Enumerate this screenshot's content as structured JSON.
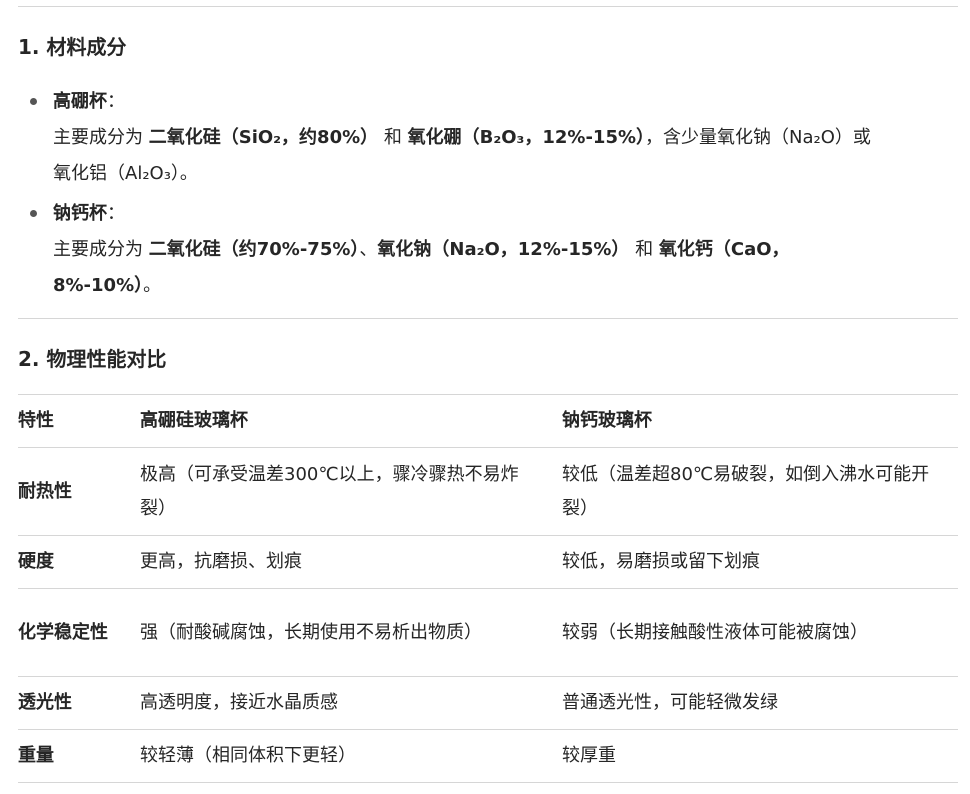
{
  "section1": {
    "title": "1. 材料成分",
    "items": [
      {
        "term": "高硼杯",
        "colon": "：",
        "lines": [
          {
            "a": "主要成分为 ",
            "b1": "二氧化硅（SiO₂，约80%）",
            "c": " 和 ",
            "b2": "氧化硼（B₂O₃，12%-15%）",
            "d": "，含少量氧化钠（Na₂O）或"
          },
          {
            "text": "氧化铝（Al₂O₃）。"
          }
        ]
      },
      {
        "term": "钠钙杯",
        "colon": "：",
        "lines": [
          {
            "a": "主要成分为 ",
            "b1": "二氧化硅（约70%-75%）",
            "c": "、",
            "b2": "氧化钠（Na₂O，12%-15%）",
            "d": " 和 ",
            "b3": "氧化钙（CaO，"
          },
          {
            "b": "8%-10%）",
            "text": "。"
          }
        ]
      }
    ]
  },
  "section2": {
    "title": "2. 物理性能对比",
    "table": {
      "headers": [
        "特性",
        "高硼硅玻璃杯",
        "钠钙玻璃杯"
      ],
      "rows": [
        {
          "k": "耐热性",
          "a": "极高（可承受温差300℃以上，骤冷骤热不易炸裂）",
          "b": "较低（温差超80℃易破裂，如倒入沸水可能开裂）"
        },
        {
          "k": "硬度",
          "a": "更高，抗磨损、划痕",
          "b": "较低，易磨损或留下划痕"
        },
        {
          "k": "化学稳定性",
          "a": "强（耐酸碱腐蚀，长期使用不易析出物质）",
          "b": "较弱（长期接触酸性液体可能被腐蚀）"
        },
        {
          "k": "透光性",
          "a": "高透明度，接近水晶质感",
          "b": "普通透光性，可能轻微发绿"
        },
        {
          "k": "重量",
          "a": "较轻薄（相同体积下更轻）",
          "b": "较厚重"
        }
      ]
    }
  }
}
